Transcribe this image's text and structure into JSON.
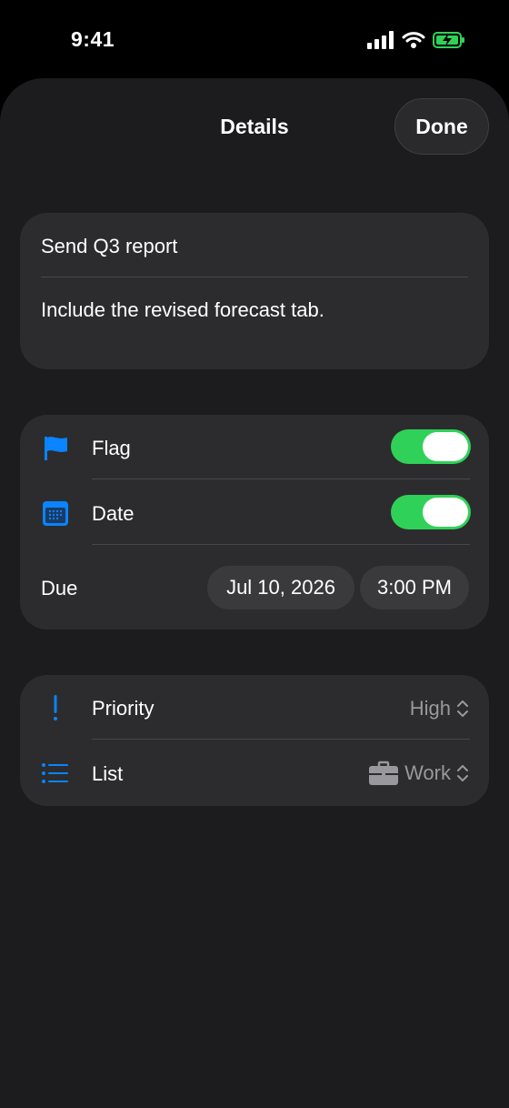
{
  "status": {
    "time": "9:41"
  },
  "nav": {
    "title": "Details",
    "done_label": "Done"
  },
  "task": {
    "title": "Send Q3 report",
    "notes": "Include the revised forecast tab."
  },
  "flag": {
    "label": "Flag",
    "enabled": true
  },
  "date": {
    "label": "Date",
    "enabled": true
  },
  "due": {
    "label": "Due",
    "date": "Jul 10, 2026",
    "time": "3:00 PM"
  },
  "priority": {
    "label": "Priority",
    "value": "High"
  },
  "list": {
    "label": "List",
    "value": "Work"
  },
  "colors": {
    "accent": "#0a84ff",
    "toggle_on": "#30d158",
    "battery": "#30d158"
  }
}
